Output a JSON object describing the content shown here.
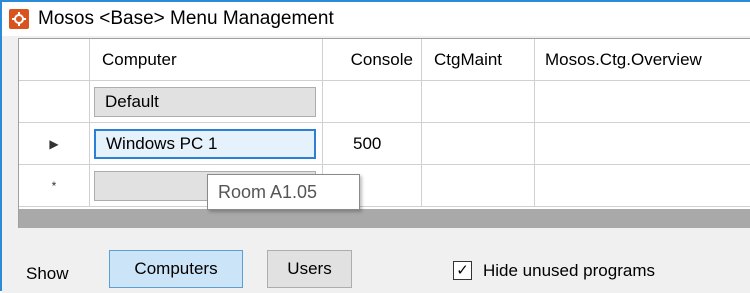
{
  "window": {
    "title": "Mosos <Base> Menu Management",
    "icon": "gear-icon",
    "accent_color": "#2b8bd6",
    "icon_color": "#d9531e"
  },
  "grid": {
    "columns": [
      "",
      "Computer",
      "Console",
      "CtgMaint",
      "Mosos.Ctg.Overview"
    ],
    "rows": [
      {
        "indicator": "",
        "computer": "Default",
        "console": ""
      },
      {
        "indicator": "▶",
        "computer": "Windows PC 1",
        "console": "500"
      },
      {
        "indicator": "*",
        "computer": "",
        "console": ""
      }
    ]
  },
  "tooltip": {
    "text": "Room A1.05"
  },
  "bottom": {
    "show_label": "Show",
    "computers_button": "Computers",
    "users_button": "Users",
    "hide_unused_label": "Hide unused programs",
    "hide_unused_checked": true,
    "check_mark": "✓"
  }
}
